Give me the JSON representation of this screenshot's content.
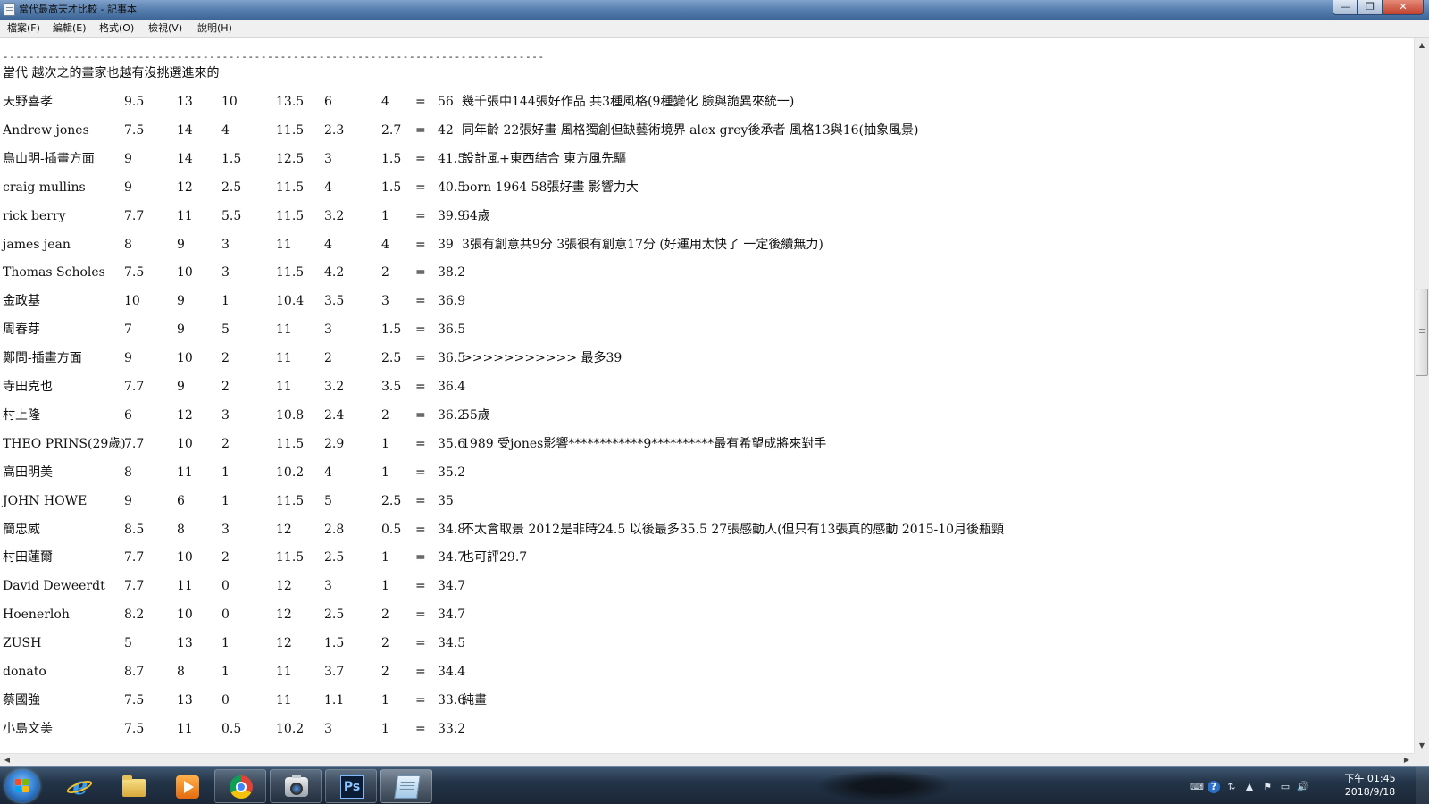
{
  "window": {
    "title": "當代最高天才比較 - 記事本",
    "minimize_glyph": "—",
    "restore_glyph": "❐",
    "close_glyph": "✕"
  },
  "menu": [
    "檔案(F)",
    "編輯(E)",
    "格式(O)",
    "檢視(V)",
    "說明(H)"
  ],
  "document": {
    "dash_line": "-----------------------------------------------------------------------------------------",
    "heading": "當代   越次之的畫家也越有沒挑選進來的",
    "rows": [
      {
        "name": "天野喜孝",
        "a": "9.5",
        "b": "13",
        "c": "10",
        "d": "13.5",
        "e": "6",
        "f": "4",
        "eq": "=",
        "total": "56",
        "note": "    幾千張中144張好作品   共3種風格(9種變化  臉與詭異來統一)"
      },
      {
        "name": "Andrew jones",
        "a": "7.5",
        "b": "14",
        "c": "4",
        "d": "11.5",
        "e": "2.3",
        "f": "2.7",
        "eq": "=",
        "total": "42",
        "note": "同年齡 22張好畫  風格獨創但缺藝術境界  alex  grey後承者  風格13與16(抽象風景)"
      },
      {
        "name": "鳥山明-插畫方面",
        "a": "9",
        "b": "14",
        "c": "1.5",
        "d": "12.5",
        "e": "3",
        "f": "1.5",
        "eq": "=",
        "total": "41.5",
        "note": "   設計風+東西結合   東方風先驅"
      },
      {
        "name": "craig mullins",
        "a": "9",
        "b": "12",
        "c": "2.5",
        "d": "11.5",
        "e": "4",
        "f": "1.5",
        "eq": "=",
        "total": "40.5",
        "note": "   born 1964  58張好畫  影響力大"
      },
      {
        "name": "rick berry",
        "a": "7.7",
        "b": "11",
        "c": "5.5",
        "d": "11.5",
        "e": "3.2",
        "f": "1",
        "eq": "=",
        "total": "39.9",
        "note": "         64歲"
      },
      {
        "name": "james jean",
        "a": "8",
        "b": "9",
        "c": "3",
        "d": "11",
        "e": "4",
        "f": "4",
        "eq": "=",
        "total": "39",
        "note": "3張有創意共9分  3張很有創意17分  (好運用太快了  一定後續無力)"
      },
      {
        "name": "Thomas Scholes",
        "a": "7.5",
        "b": "10",
        "c": "3",
        "d": "11.5",
        "e": "4.2",
        "f": "2",
        "eq": "=",
        "total": "38.2",
        "note": ""
      },
      {
        "name": "金政基",
        "a": "10",
        "b": "9",
        "c": "1",
        "d": "10.4",
        "e": "3.5",
        "f": "3",
        "eq": "=",
        "total": "36.9",
        "note": ""
      },
      {
        "name": "周春芽",
        "a": "7",
        "b": "9",
        "c": "5",
        "d": "11",
        "e": "3",
        "f": "1.5",
        "eq": "=",
        "total": "36.5",
        "note": ""
      },
      {
        "name": "鄭問-插畫方面",
        "a": "9",
        "b": "10",
        "c": "2",
        "d": "11",
        "e": "2",
        "f": "2.5",
        "eq": "=",
        "total": "36.5",
        "note": ">>>>>>>>>>>  最多39"
      },
      {
        "name": "寺田克也",
        "a": "7.7",
        "b": "9",
        "c": "2",
        "d": "11",
        "e": "3.2",
        "f": "3.5",
        "eq": "=",
        "total": "36.4",
        "note": ""
      },
      {
        "name": "村上隆",
        "a": "6",
        "b": "12",
        "c": "3",
        "d": "10.8",
        "e": "2.4",
        "f": "2",
        "eq": "=",
        "total": "36.2",
        "note": "    55歲"
      },
      {
        "name": "THEO PRINS(29歲)",
        "a": "7.7",
        "b": "10",
        "c": "2",
        "d": "11.5",
        "e": "2.9",
        "f": "1",
        "eq": "=",
        "total": "35.6",
        "note": "  1989   受jones影響************9**********最有希望成將來對手"
      },
      {
        "name": "高田明美",
        "a": "8",
        "b": "11",
        "c": "1",
        "d": "10.2",
        "e": "4",
        "f": "1",
        "eq": "=",
        "total": "35.2",
        "note": ""
      },
      {
        "name": "JOHN HOWE",
        "a": "9",
        "b": "6",
        "c": "1",
        "d": "11.5",
        "e": "5",
        "f": "2.5",
        "eq": "=",
        "total": "35",
        "note": ""
      },
      {
        "name": "簡忠威",
        "a": "8.5",
        "b": "8",
        "c": "3",
        "d": "12",
        "e": "2.8",
        "f": "0.5",
        "eq": "=",
        "total": "34.8",
        "note": "        不太會取景 2012是非時24.5   以後最多35.5    27張感動人(但只有13張真的感動   2015-10月後瓶頸"
      },
      {
        "name": "村田蓮爾",
        "a": "7.7",
        "b": "10",
        "c": "2",
        "d": "11.5",
        "e": "2.5",
        "f": "1",
        "eq": "=",
        "total": "34.7",
        "note": "    也可評29.7"
      },
      {
        "name": "David Deweerdt",
        "a": "7.7",
        "b": "11",
        "c": "0",
        "d": "12",
        "e": "3",
        "f": "1",
        "eq": "=",
        "total": "34.7",
        "note": ""
      },
      {
        "name": "Hoenerloh",
        "a": "8.2",
        "b": "10",
        "c": "0",
        "d": "12",
        "e": "2.5",
        "f": "2",
        "eq": "=",
        "total": "34.7",
        "note": ""
      },
      {
        "name": "ZUSH",
        "a": "5",
        "b": "13",
        "c": "1",
        "d": "12",
        "e": "1.5",
        "f": "2",
        "eq": "=",
        "total": "34.5",
        "note": ""
      },
      {
        "name": "donato",
        "a": "8.7",
        "b": "8",
        "c": "1",
        "d": "11",
        "e": "3.7",
        "f": "2",
        "eq": "=",
        "total": "34.4",
        "note": ""
      },
      {
        "name": "蔡國強",
        "a": "7.5",
        "b": "13",
        "c": "0",
        "d": "11",
        "e": "1.1",
        "f": "1",
        "eq": "=",
        "total": "33.6",
        "note": "   純畫"
      },
      {
        "name": "小島文美",
        "a": "7.5",
        "b": "11",
        "c": "0.5",
        "d": "10.2",
        "e": "3",
        "f": "1",
        "eq": "=",
        "total": "33.2",
        "note": ""
      }
    ]
  },
  "scrollbars": {
    "up": "▲",
    "down": "▼",
    "left": "◀",
    "right": "▶"
  },
  "taskbar": {
    "apps": [
      {
        "name": "internet-explorer",
        "glyph": "e"
      },
      {
        "name": "file-explorer",
        "glyph": ""
      },
      {
        "name": "media-player",
        "glyph": ""
      },
      {
        "name": "chrome",
        "glyph": ""
      },
      {
        "name": "camera",
        "glyph": ""
      },
      {
        "name": "photoshop",
        "glyph": "Ps"
      },
      {
        "name": "notepad",
        "glyph": ""
      }
    ],
    "tray_icons": [
      "⌨",
      "?",
      "⇅",
      "▲",
      "⚑",
      "▭",
      "🔊"
    ],
    "clock_time": "下午 01:45",
    "clock_date": "2018/9/18"
  }
}
